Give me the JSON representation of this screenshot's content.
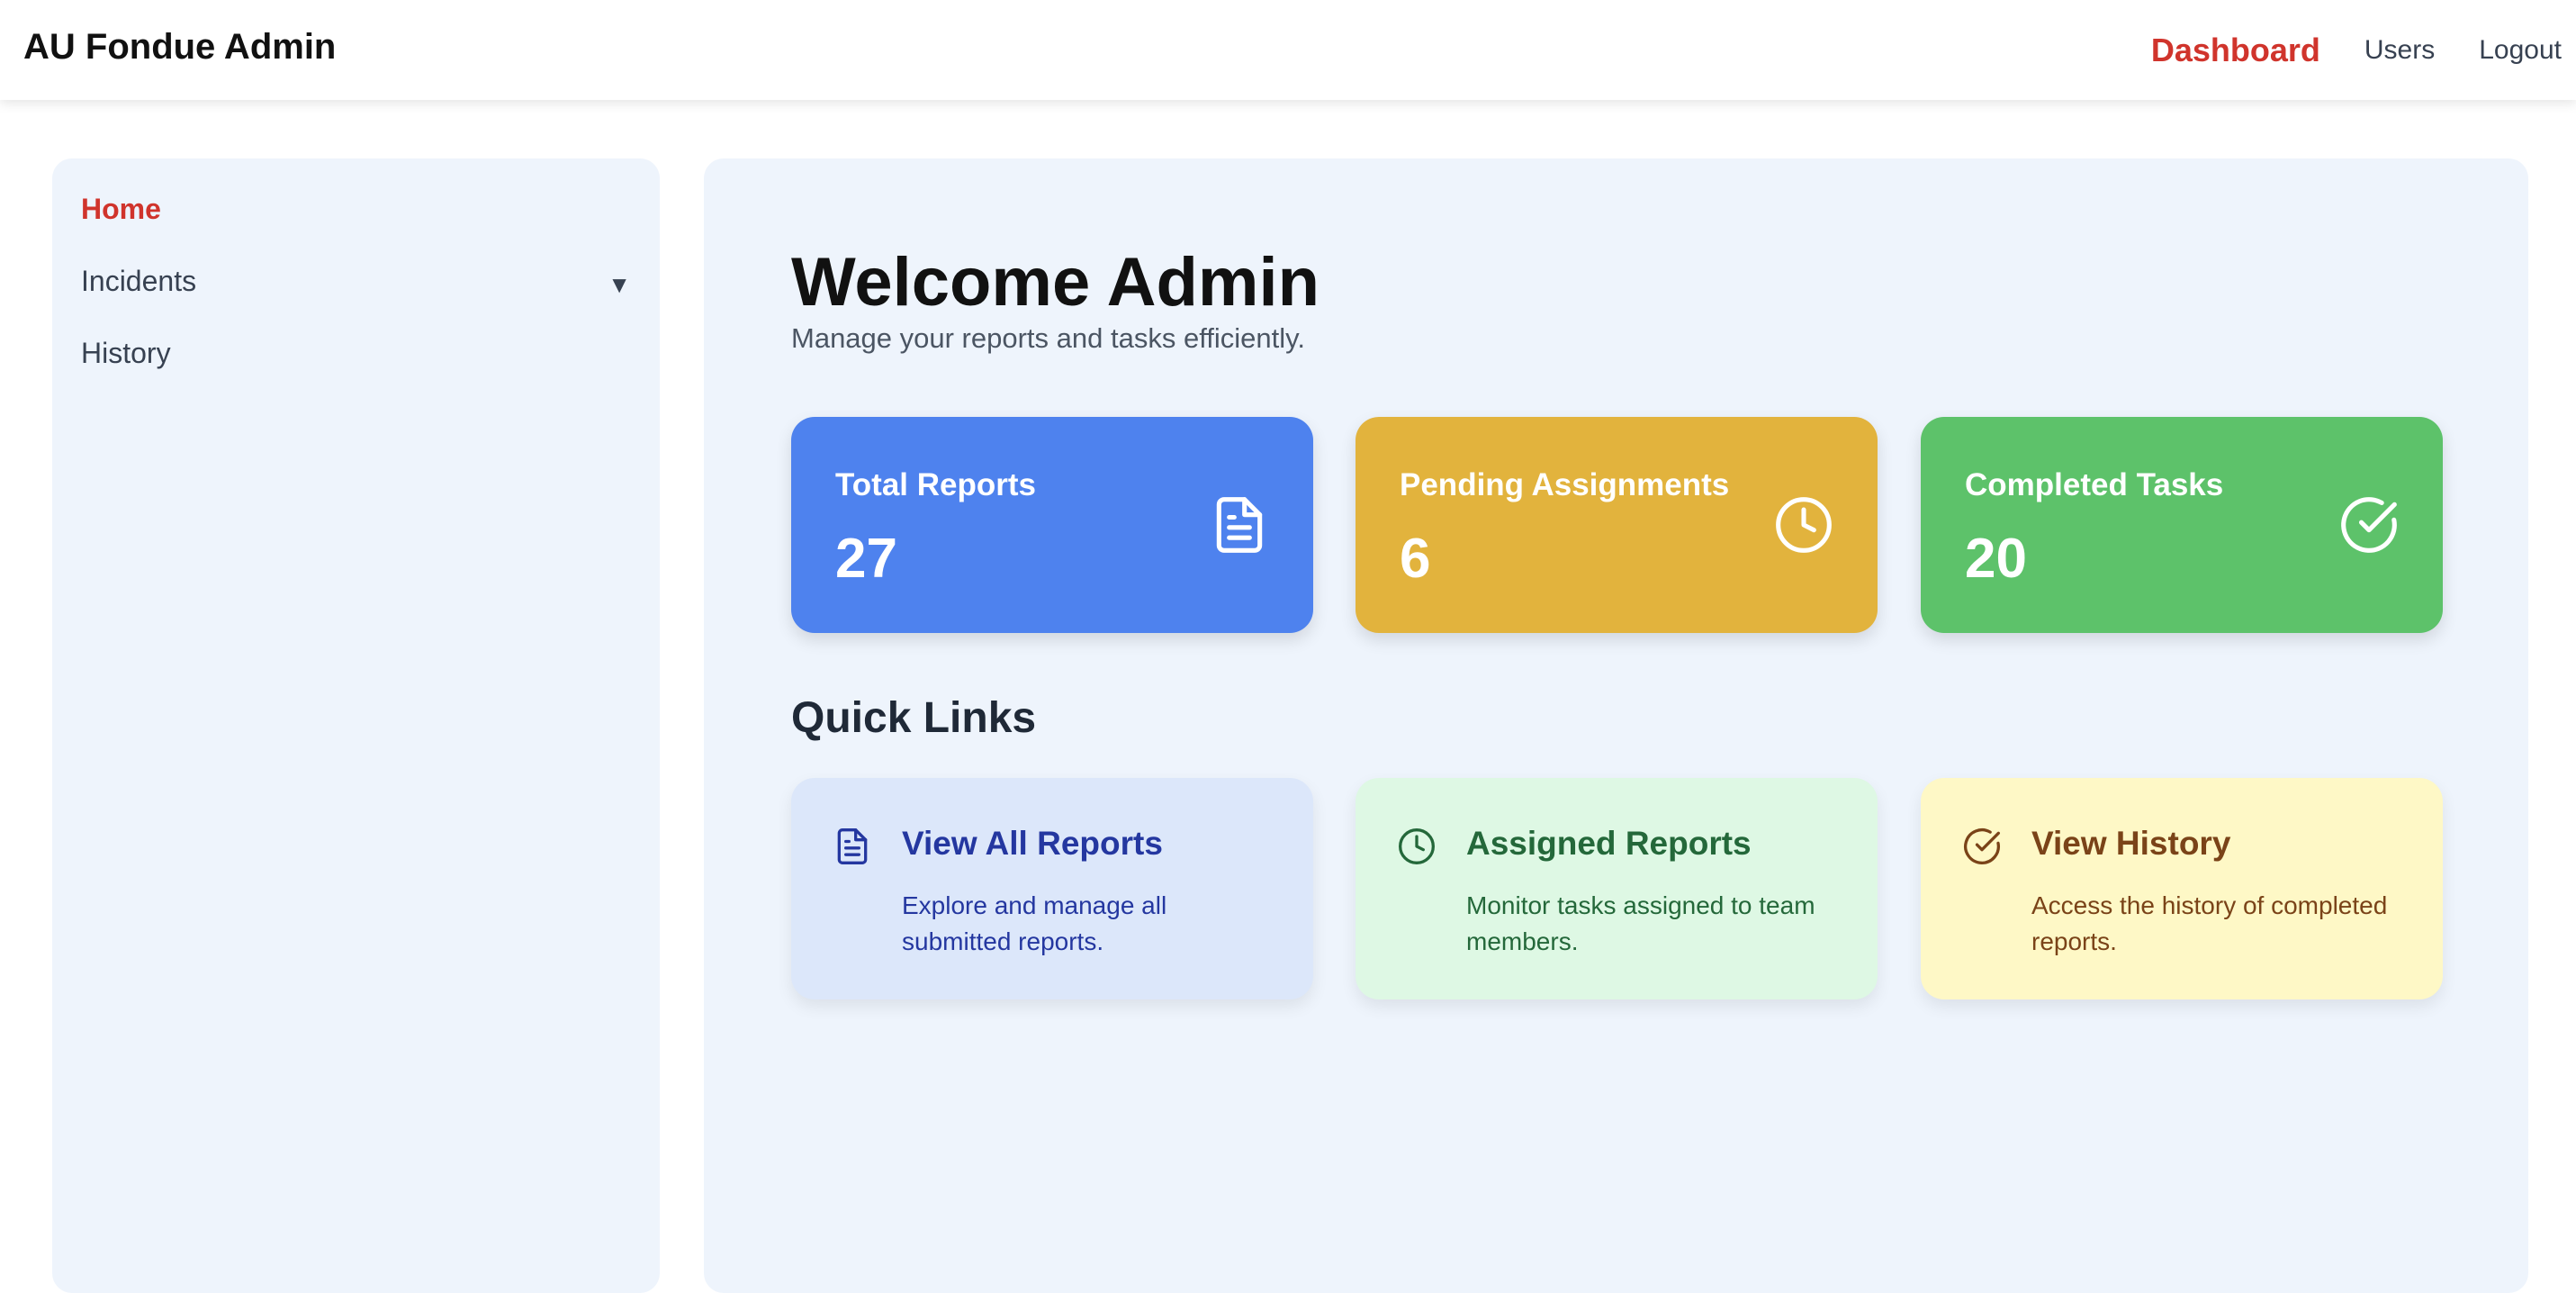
{
  "header": {
    "brand": "AU Fondue Admin",
    "nav": [
      {
        "label": "Dashboard",
        "active": true
      },
      {
        "label": "Users",
        "active": false
      },
      {
        "label": "Logout",
        "active": false
      }
    ]
  },
  "sidebar": {
    "items": [
      {
        "label": "Home",
        "active": true
      },
      {
        "label": "Incidents",
        "active": false,
        "expandable": true,
        "caret": "▼"
      },
      {
        "label": "History",
        "active": false
      }
    ]
  },
  "main": {
    "title": "Welcome Admin",
    "subtitle": "Manage your reports and tasks efficiently.",
    "stats": [
      {
        "label": "Total Reports",
        "value": "27",
        "icon": "document-icon",
        "color": "#4e82ee"
      },
      {
        "label": "Pending Assignments",
        "value": "6",
        "icon": "clock-icon",
        "color": "#e2b33d"
      },
      {
        "label": "Completed Tasks",
        "value": "20",
        "icon": "check-circle-icon",
        "color": "#5dc26a"
      }
    ],
    "quick_links_heading": "Quick Links",
    "quick_links": [
      {
        "title": "View All Reports",
        "description": "Explore and manage all submitted reports.",
        "icon": "document-icon",
        "color": "#2437a0"
      },
      {
        "title": "Assigned Reports",
        "description": "Monitor tasks assigned to team members.",
        "icon": "clock-icon",
        "color": "#24683a"
      },
      {
        "title": "View History",
        "description": "Access the history of completed reports.",
        "icon": "check-circle-icon",
        "color": "#7a4318"
      }
    ]
  },
  "colors": {
    "accent_red": "#d0342c",
    "panel_bg": "#eef4fc"
  }
}
